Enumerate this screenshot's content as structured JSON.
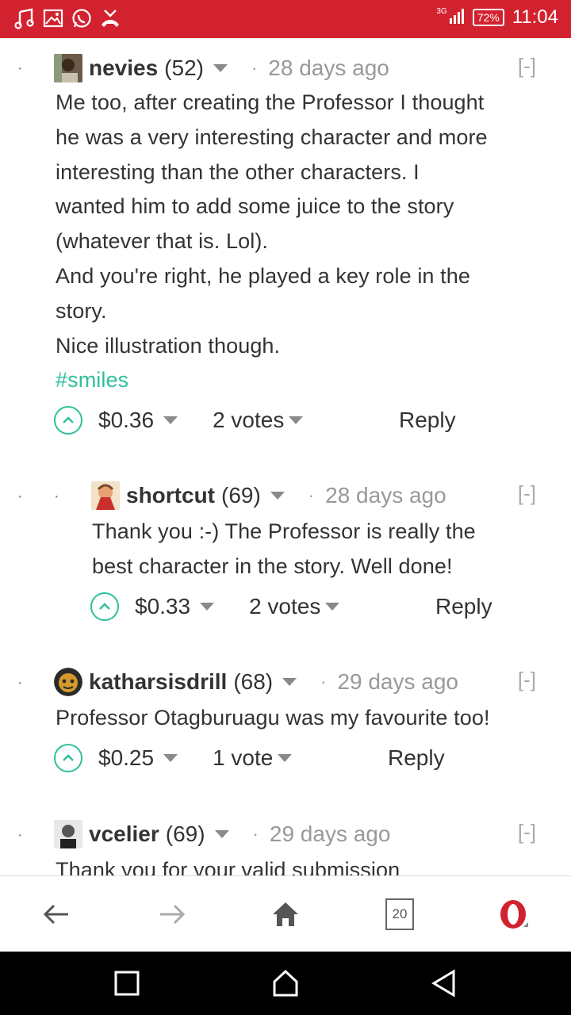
{
  "status_bar": {
    "network": "3G",
    "battery": "72%",
    "time": "11:04"
  },
  "comments": [
    {
      "author": "nevies",
      "reputation": "(52)",
      "date": "28 days ago",
      "collapse": "[-]",
      "body_lines": [
        "Me too, after creating the Professor I thought",
        "he was a very interesting character and more",
        "interesting than the other characters. I",
        "wanted him to add some juice to the story",
        "(whatever that is. Lol).",
        "And you're right, he played a key role in the",
        "story.",
        "Nice illustration though."
      ],
      "tag": "#smiles",
      "payout": "$0.36",
      "votes": "2 votes",
      "reply": "Reply"
    },
    {
      "author": "shortcut",
      "reputation": "(69)",
      "date": "28 days ago",
      "collapse": "[-]",
      "body_lines": [
        "Thank you :-) The Professor is really the",
        "best character in the story. Well done!"
      ],
      "payout": "$0.33",
      "votes": "2 votes",
      "reply": "Reply"
    },
    {
      "author": "katharsisdrill",
      "reputation": "(68)",
      "date": "29 days ago",
      "collapse": "[-]",
      "body_lines": [
        "Professor Otagburuagu was my favourite too!"
      ],
      "payout": "$0.25",
      "votes": "1 vote",
      "reply": "Reply"
    },
    {
      "author": "vcelier",
      "reputation": "(69)",
      "date": "29 days ago",
      "collapse": "[-]",
      "body_lines": [
        "Thank you for your valid submission"
      ]
    }
  ],
  "navbar": {
    "tab_count": "20"
  },
  "colors": {
    "status_bar": "#d3222f",
    "accent_teal": "#2fbf9b",
    "opera_red": "#d3222f"
  }
}
